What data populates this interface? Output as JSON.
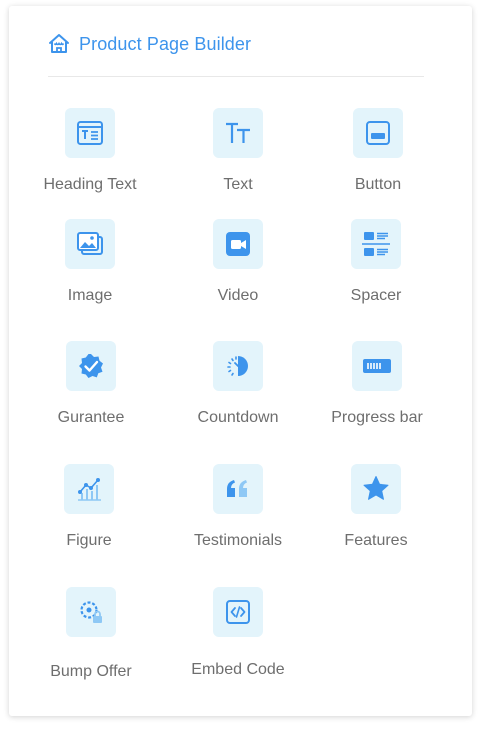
{
  "header": {
    "title": "Product Page Builder",
    "icon": "home-icon"
  },
  "colors": {
    "accent": "#3d94ec",
    "tile_bg": "#e3f4fb",
    "label": "#6e6e6e"
  },
  "widgets": [
    {
      "label": "Heading Text",
      "icon": "heading-text-icon"
    },
    {
      "label": "Text",
      "icon": "text-icon"
    },
    {
      "label": "Button",
      "icon": "button-icon"
    },
    {
      "label": "Image",
      "icon": "image-icon"
    },
    {
      "label": "Video",
      "icon": "video-icon"
    },
    {
      "label": "Spacer",
      "icon": "spacer-icon"
    },
    {
      "label": "Gurantee",
      "icon": "guarantee-badge-icon"
    },
    {
      "label": "Countdown",
      "icon": "countdown-timer-icon"
    },
    {
      "label": "Progress bar",
      "icon": "progress-bar-icon"
    },
    {
      "label": "Figure",
      "icon": "figure-chart-icon"
    },
    {
      "label": "Testimonials",
      "icon": "quote-icon"
    },
    {
      "label": "Features",
      "icon": "star-icon"
    },
    {
      "label": "Bump Offer",
      "icon": "bump-offer-icon"
    },
    {
      "label": "Embed Code",
      "icon": "embed-code-icon"
    }
  ]
}
